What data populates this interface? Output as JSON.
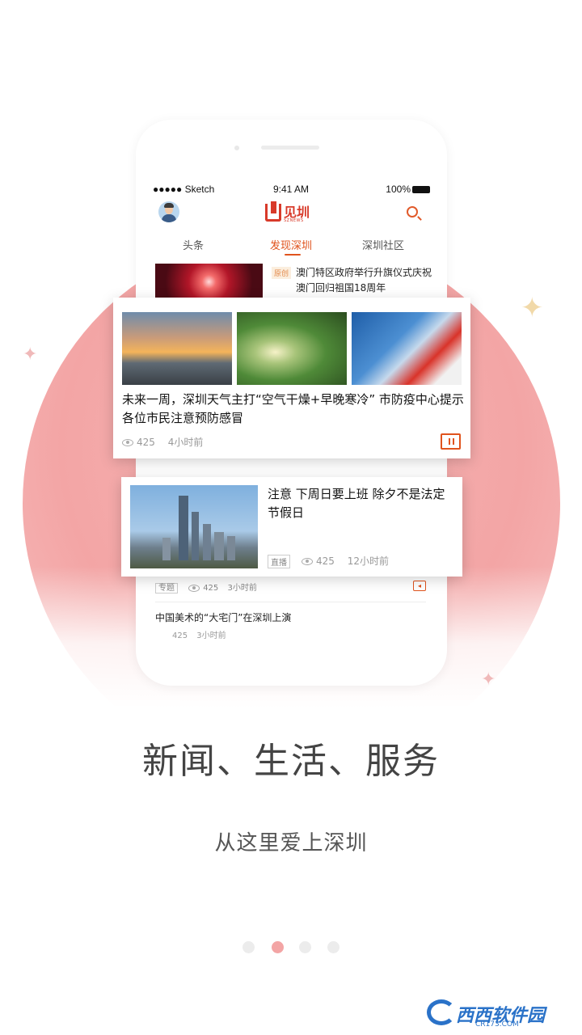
{
  "status_bar": {
    "carrier": "●●●●● Sketch",
    "time": "9:41 AM",
    "battery": "100%"
  },
  "app": {
    "logo_text": "见圳",
    "logo_sub": "SZNEWS"
  },
  "tabs": [
    {
      "label": "头条",
      "active": false
    },
    {
      "label": "发现深圳",
      "active": true
    },
    {
      "label": "深圳社区",
      "active": false
    }
  ],
  "feed": {
    "item1": {
      "tag": "原创",
      "title": "澳门特区政府举行升旗仪式庆祝澳门回归祖国18周年"
    },
    "card1": {
      "title": "未来一周，深圳天气主打“空气干燥+早晚寒冷” 市防疫中心提示各位市民注意预防感冒",
      "views": "425",
      "time": "4小时前"
    },
    "card2": {
      "title": "注意 下周日要上班 除夕不是法定节假日",
      "tag": "直播",
      "views": "425",
      "time": "12小时前"
    },
    "item3": {
      "tag": "专题",
      "views": "425",
      "time": "3小时前"
    },
    "item4": {
      "title": "中国美术的“大宅门”在深圳上演",
      "views": "425",
      "time": "3小时前"
    }
  },
  "promo": {
    "headline": "新闻、生活、服务",
    "subline": "从这里爱上深圳"
  },
  "pager": {
    "count": 4,
    "active_index": 1
  },
  "watermark": {
    "text": "西西软件园",
    "url": "CR173.COM"
  },
  "colors": {
    "accent": "#e0531d",
    "circle": "#f3a5a5",
    "brand_red": "#d83a2a"
  }
}
